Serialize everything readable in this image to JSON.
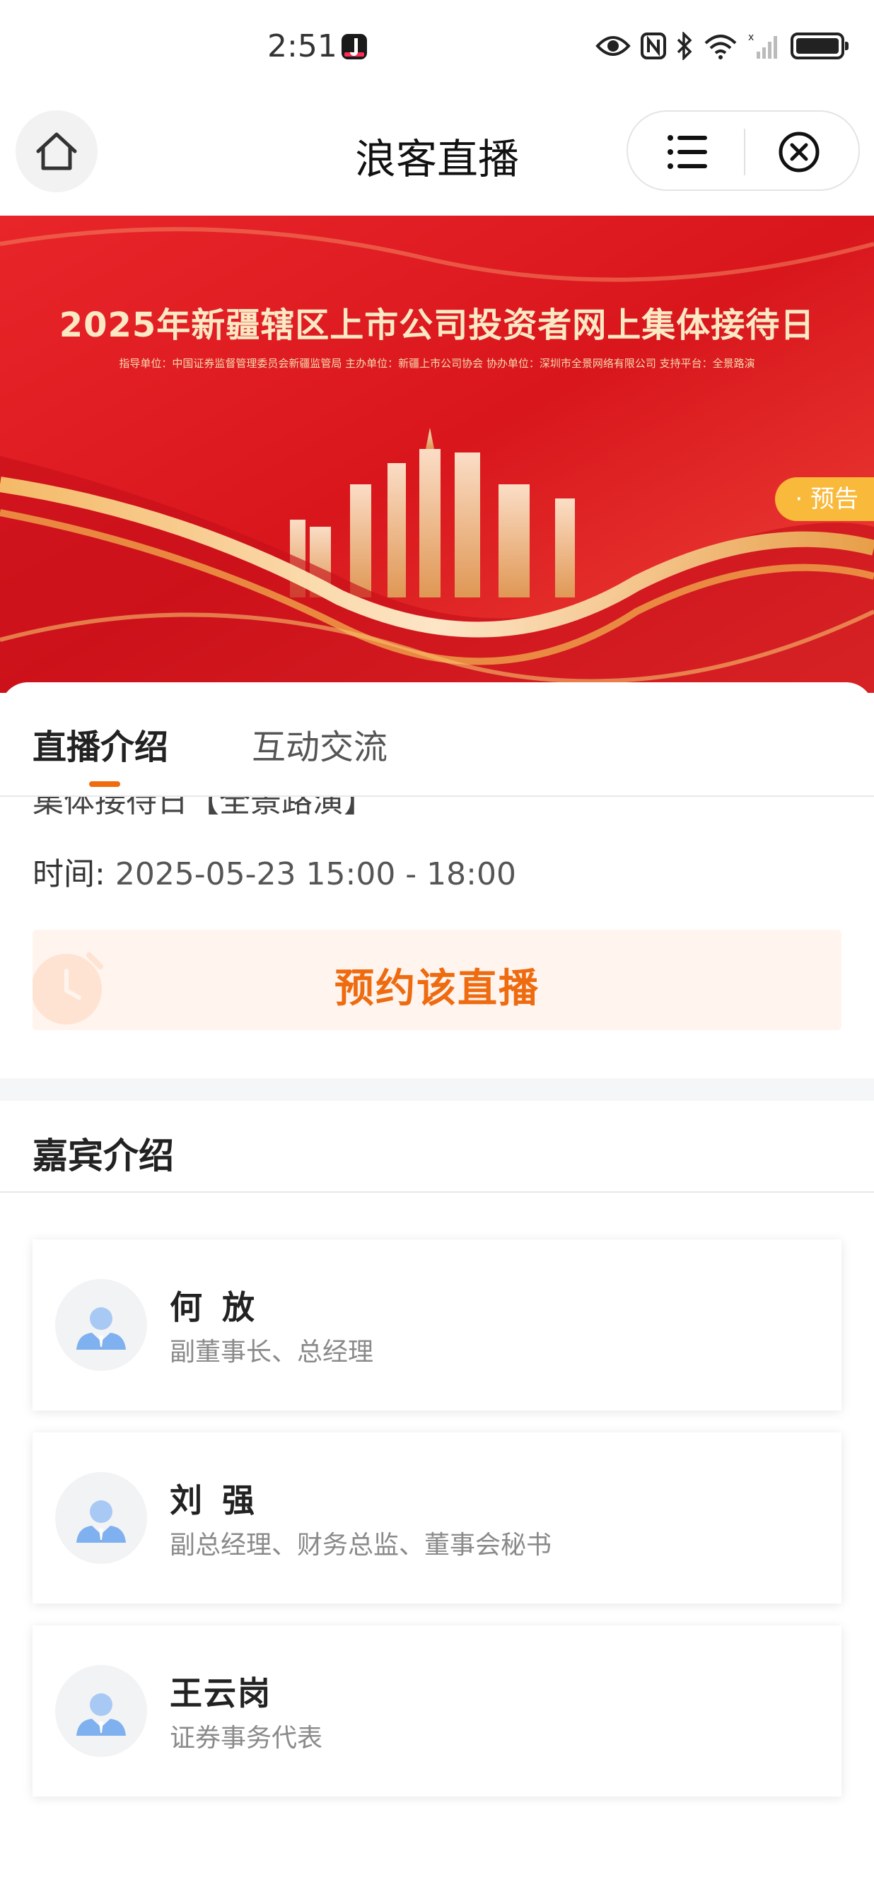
{
  "status_bar": {
    "time": "2:51"
  },
  "nav": {
    "title": "浪客直播"
  },
  "banner": {
    "title": "2025年新疆辖区上市公司投资者网上集体接待日",
    "subtitle": "指导单位：中国证券监督管理委员会新疆监管局    主办单位：新疆上市公司协会    协办单位：深圳市全景网络有限公司    支持平台：全景路演",
    "badge": "· 预告"
  },
  "tabs": [
    {
      "label": "直播介绍",
      "active": true
    },
    {
      "label": "互动交流",
      "active": false
    }
  ],
  "intro": {
    "cut_text": "集体接待日【全景路演】",
    "time_label": "时间:",
    "time_value": "2025-05-23 15:00 - 18:00",
    "reserve_label": "预约该直播"
  },
  "guests": {
    "heading": "嘉宾介绍",
    "items": [
      {
        "name": "何 放",
        "role": "副董事长、总经理"
      },
      {
        "name": "刘 强",
        "role": "副总经理、财务总监、董事会秘书"
      },
      {
        "name": "王云岗",
        "role": "证券事务代表"
      }
    ]
  },
  "colors": {
    "accent": "#f06a0e",
    "badge": "#f9b93a",
    "banner_red": "#d8161c"
  }
}
